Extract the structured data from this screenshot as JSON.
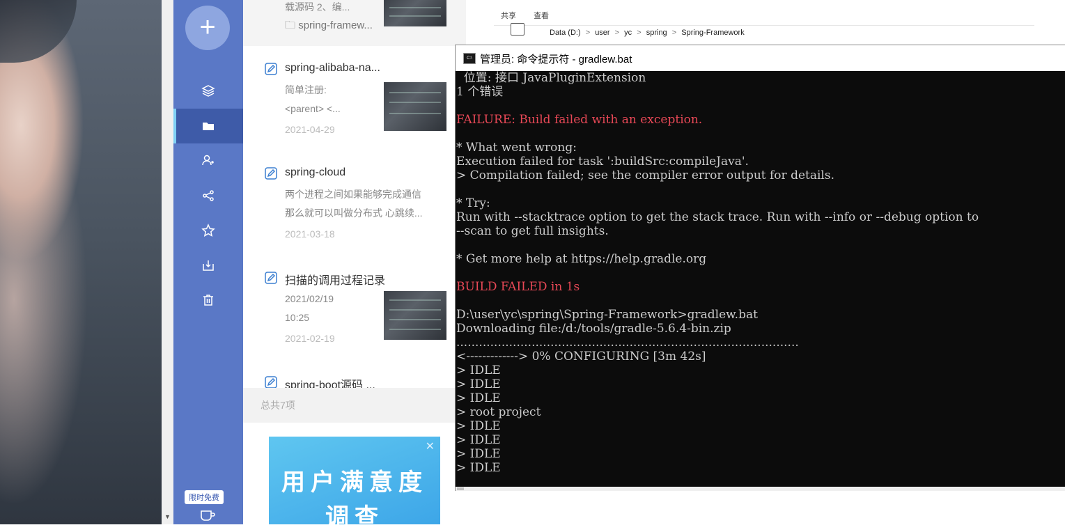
{
  "sidebar": {
    "add_label": "+",
    "nav_icons": [
      "layers-icon",
      "folder-icon",
      "users-icon",
      "share-icon",
      "star-icon",
      "download-box-icon",
      "trash-icon"
    ],
    "promo_badge": "限时免费"
  },
  "notes": [
    {
      "snippet": "载源码 2、编...",
      "folder": "spring-framew..."
    },
    {
      "title": "spring-alibaba-na...",
      "snippet1": "简单注册:",
      "snippet2": "<parent> <...",
      "date": "2021-04-29"
    },
    {
      "title": "spring-cloud",
      "snippet1": "两个进程之间如果能够完成通信",
      "snippet2": "那么就可以叫做分布式 心跳续...",
      "date": "2021-03-18"
    },
    {
      "title": "扫描的调用过程记录",
      "snippet1": "2021/02/19",
      "snippet2": "10:25",
      "date": "2021-02-19"
    },
    {
      "title": "spring-boot源码 ..."
    }
  ],
  "total_label": "总共7项",
  "ad": {
    "line1": "用户满意度",
    "line2": "调查"
  },
  "explorer": {
    "tabs": [
      "共享",
      "查看"
    ],
    "breadcrumbs": [
      "Data (D:)",
      "user",
      "yc",
      "spring",
      "Spring-Framework"
    ],
    "sep": ">"
  },
  "cmd": {
    "title": "管理员: 命令提示符 - gradlew.bat",
    "lines": [
      {
        "t": "  位置: 接口 JavaPluginExtension"
      },
      {
        "t": "1 个错误"
      },
      {
        "t": ""
      },
      {
        "t": "FAILURE: Build failed with an exception.",
        "c": "red"
      },
      {
        "t": ""
      },
      {
        "t": "* What went wrong:"
      },
      {
        "t": "Execution failed for task ':buildSrc:compileJava'."
      },
      {
        "t": "> Compilation failed; see the compiler error output for details."
      },
      {
        "t": ""
      },
      {
        "t": "* Try:"
      },
      {
        "t": "Run with --stacktrace option to get the stack trace. Run with --info or --debug option to"
      },
      {
        "t": "--scan to get full insights."
      },
      {
        "t": ""
      },
      {
        "t": "* Get more help at https://help.gradle.org"
      },
      {
        "t": ""
      },
      {
        "t": "BUILD FAILED in 1s",
        "c": "red"
      },
      {
        "t": ""
      },
      {
        "t": "D:\\user\\yc\\spring\\Spring-Framework>gradlew.bat"
      },
      {
        "t": "Downloading file:/d:/tools/gradle-5.6.4-bin.zip"
      },
      {
        "t": "..........................................................................................."
      },
      {
        "t": "<-------------> 0% CONFIGURING [3m 42s]"
      },
      {
        "t": "> IDLE"
      },
      {
        "t": "> IDLE"
      },
      {
        "t": "> IDLE"
      },
      {
        "t": "> root project"
      },
      {
        "t": "> IDLE"
      },
      {
        "t": "> IDLE"
      },
      {
        "t": "> IDLE"
      },
      {
        "t": "> IDLE"
      }
    ]
  },
  "colors": {
    "sidebar": "#5a78c6",
    "sidebar_active": "#3e5ba8",
    "terminal_bg": "#0c0c0c",
    "error_red": "#e74856"
  }
}
